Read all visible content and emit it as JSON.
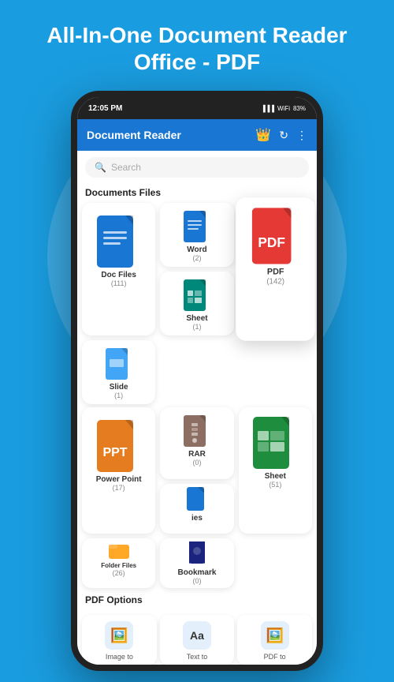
{
  "header": {
    "title": "All-In-One Document Reader Office - PDF"
  },
  "status_bar": {
    "time": "12:05 PM",
    "battery": "83%"
  },
  "app_bar": {
    "title": "Document Reader"
  },
  "search": {
    "placeholder": "Search"
  },
  "sections": {
    "documents_title": "Documents Files",
    "pdf_options_title": "PDF Options"
  },
  "doc_cards": [
    {
      "id": "doc",
      "label": "Doc Files",
      "count": "(111)",
      "type": "large",
      "color": "blue",
      "text": ""
    },
    {
      "id": "word",
      "label": "Word",
      "count": "(2)",
      "type": "small",
      "color": "blue",
      "text": ""
    },
    {
      "id": "pdf",
      "label": "PDF",
      "count": "(142)",
      "type": "large",
      "color": "red",
      "text": "PDF"
    },
    {
      "id": "slide",
      "label": "Slide",
      "count": "(1)",
      "type": "small",
      "color": "blue-light",
      "text": ""
    },
    {
      "id": "sheet",
      "label": "Sheet",
      "count": "(1)",
      "type": "small",
      "color": "teal",
      "text": ""
    },
    {
      "id": "power_point",
      "label": "Power Point",
      "count": "(17)",
      "type": "large",
      "color": "orange",
      "text": "PPT"
    },
    {
      "id": "rar",
      "label": "RAR",
      "count": "(0)",
      "type": "small",
      "color": "brown",
      "text": ""
    },
    {
      "id": "sheet2",
      "label": "Sheet",
      "count": "(51)",
      "type": "large",
      "color": "green",
      "text": ""
    },
    {
      "id": "folder",
      "label": "Folder Files",
      "count": "(26)",
      "type": "small",
      "color": "orange",
      "text": ""
    },
    {
      "id": "ies",
      "label": "ies",
      "count": "",
      "type": "small",
      "color": "blue",
      "text": ""
    },
    {
      "id": "bookmark",
      "label": "Bookmark",
      "count": "(0)",
      "type": "small",
      "color": "dark-blue",
      "text": ""
    }
  ],
  "pdf_options": [
    {
      "id": "image-to",
      "label": "Image to",
      "icon": "🖼️"
    },
    {
      "id": "text-to",
      "label": "Text to",
      "icon": "Aa"
    },
    {
      "id": "pdf-to",
      "label": "PDF to",
      "icon": "🖼️"
    }
  ]
}
